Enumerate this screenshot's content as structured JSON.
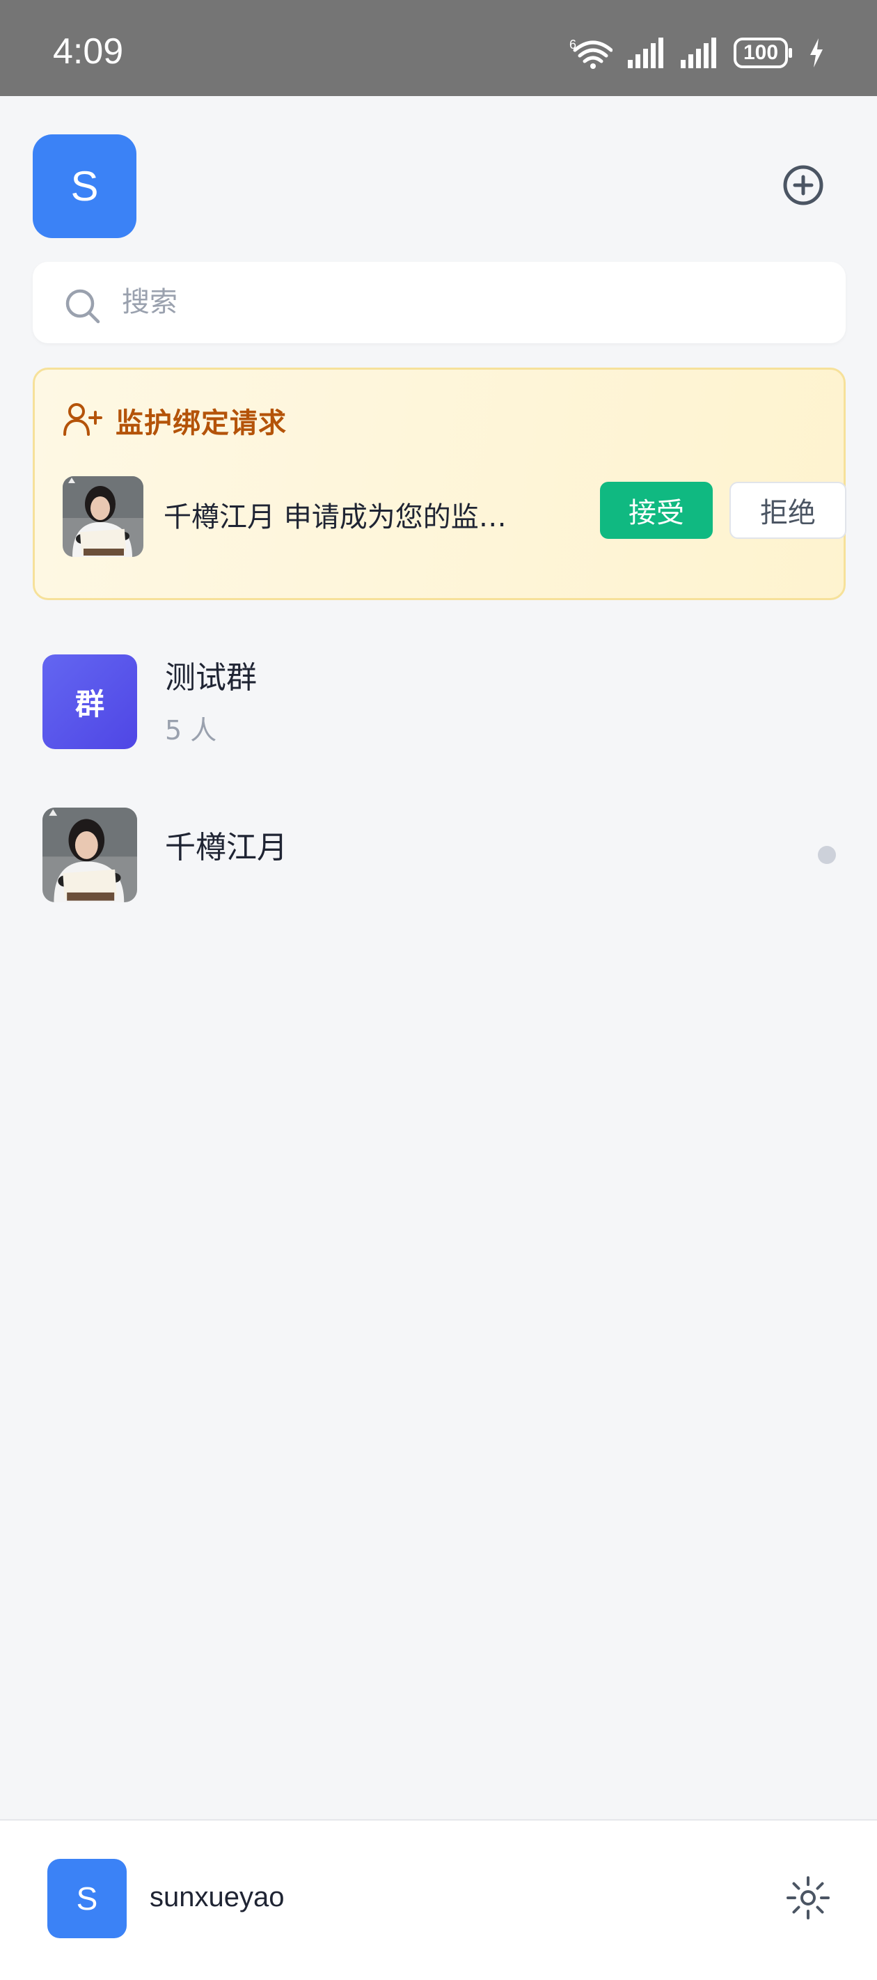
{
  "status_bar": {
    "time": "4:09",
    "network_tag": "6",
    "battery_level": "100",
    "icons": [
      "wifi-icon",
      "signal-icon",
      "signal-icon",
      "battery-icon",
      "charging-icon"
    ]
  },
  "header": {
    "avatar_initial": "S",
    "add_icon": "plus-circle-icon"
  },
  "search": {
    "placeholder": "搜索",
    "value": "",
    "icon": "search-icon"
  },
  "guardian_request": {
    "title": "监护绑定请求",
    "title_icon": "user-plus-icon",
    "requester_avatar": "photo-avatar",
    "message": "千樽江月 申请成为您的监…",
    "accept_label": "接受",
    "reject_label": "拒绝"
  },
  "conversations": [
    {
      "name": "测试群",
      "avatar_text": "群",
      "subtitle": "5 人",
      "type": "group"
    },
    {
      "name": "千樽江月",
      "avatar": "photo-avatar",
      "type": "user",
      "status": "offline"
    }
  ],
  "bottom_bar": {
    "avatar_initial": "S",
    "username": "sunxueyao",
    "settings_icon": "gear-icon"
  },
  "colors": {
    "accent_blue": "#3B82F6",
    "accept_green": "#10B981",
    "request_title": "#B45309",
    "group_avatar": "#5B5CE8",
    "status_bar": "#757575"
  }
}
